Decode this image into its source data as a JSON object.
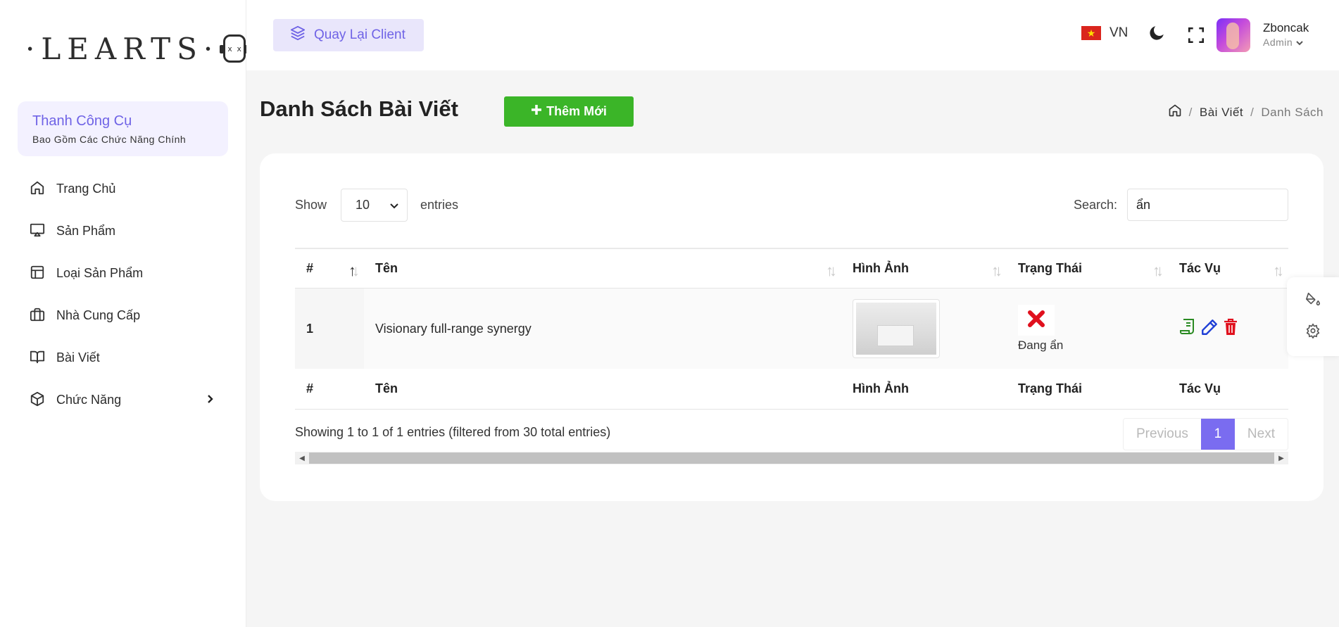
{
  "sidebar": {
    "logo_text": "·LEARTS·",
    "logo_face_text": "x x",
    "toolbox": {
      "title": "Thanh Công Cụ",
      "subtitle": "Bao Gồm Các Chức Năng Chính"
    },
    "items": [
      {
        "label": "Trang Chủ",
        "icon": "home-icon"
      },
      {
        "label": "Sản Phẩm",
        "icon": "monitor-icon"
      },
      {
        "label": "Loại Sản Phẩm",
        "icon": "layout-icon"
      },
      {
        "label": "Nhà Cung Cấp",
        "icon": "briefcase-icon"
      },
      {
        "label": "Bài Viết",
        "icon": "book-icon"
      },
      {
        "label": "Chức Năng",
        "icon": "cube-icon",
        "has_submenu": true
      }
    ]
  },
  "topbar": {
    "back_button": "Quay Lại Client",
    "language": "VN",
    "user": {
      "name": "Zboncak",
      "role": "Admin"
    }
  },
  "page": {
    "title": "Danh Sách Bài Viết",
    "add_button": "Thêm Mới",
    "breadcrumb": [
      "Bài Viết",
      "Danh Sách"
    ]
  },
  "table_controls": {
    "show_label": "Show",
    "page_length": "10",
    "entries_label": "entries",
    "search_label": "Search:",
    "search_value": "ẩn"
  },
  "table": {
    "columns": [
      "#",
      "Tên",
      "Hình Ảnh",
      "Trạng Thái",
      "Tác Vụ"
    ],
    "rows": [
      {
        "index": "1",
        "name": "Visionary full-range synergy",
        "status": "Đang ẩn"
      }
    ],
    "info": "Showing 1 to 1 of 1 entries (filtered from 30 total entries)",
    "pagination": {
      "previous": "Previous",
      "current": "1",
      "next": "Next"
    }
  },
  "colors": {
    "accent": "#6f63e6",
    "add_button": "#3bb528",
    "status_hidden": "#e0101d",
    "page_active": "#7a6cf0"
  }
}
